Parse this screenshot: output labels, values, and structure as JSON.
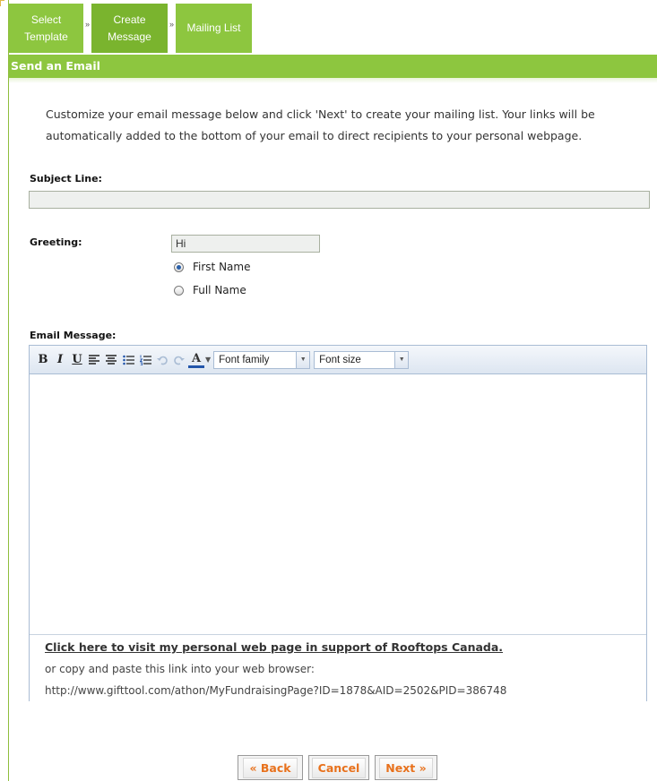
{
  "wizard": {
    "steps": [
      {
        "line1": "Select",
        "line2": "Template"
      },
      {
        "line1": "Create",
        "line2": "Message"
      },
      {
        "line1": "Mailing List",
        "line2": ""
      }
    ],
    "separator": "»"
  },
  "header": {
    "title": "Send an Email"
  },
  "intro": "Customize your email message below and click 'Next' to create your mailing list. Your links will be automatically added to the bottom of your email to direct recipients to your personal webpage.",
  "subject": {
    "label": "Subject Line:",
    "value": ""
  },
  "greeting": {
    "label": "Greeting:",
    "value": "Hi",
    "options": [
      "First Name",
      "Full Name"
    ],
    "selected": "First Name"
  },
  "message": {
    "label": "Email Message:",
    "toolbar": {
      "bold": "B",
      "italic": "I",
      "underline": "U",
      "color_letter": "A",
      "font_family": "Font family",
      "font_size": "Font size",
      "icons": [
        "bold-icon",
        "italic-icon",
        "underline-icon",
        "align-left-icon",
        "align-center-icon",
        "bullet-list-icon",
        "numbered-list-icon",
        "undo-icon",
        "redo-icon",
        "text-color-icon"
      ]
    },
    "footer": {
      "link_text": "Click here to visit my personal web page in support of Rooftops Canada.",
      "copy_text": "or copy and paste this link into your web browser:",
      "url": "http://www.gifttool.com/athon/MyFundraisingPage?ID=1878&AID=2502&PID=386748"
    }
  },
  "buttons": {
    "back": "« Back",
    "cancel": "Cancel",
    "next": "Next »"
  },
  "colors": {
    "brand_green": "#8dc63f",
    "button_text": "#e8711c",
    "toolbar_border": "#a9bcd4"
  }
}
